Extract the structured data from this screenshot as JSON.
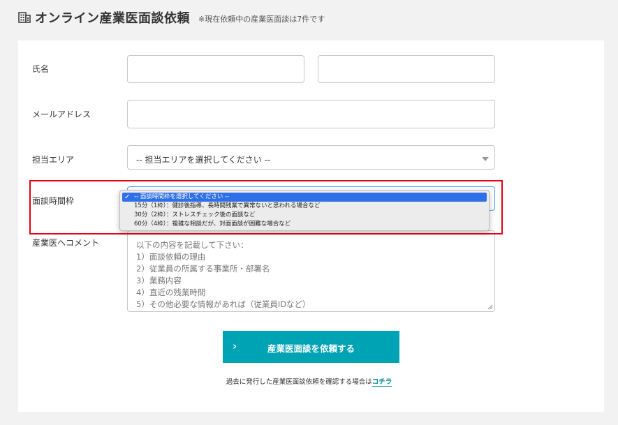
{
  "header": {
    "title": "オンライン産業医面談依頼",
    "subtitle": "※現在依頼中の産業医面談は7件です"
  },
  "form": {
    "name_label": "氏名",
    "email_label": "メールアドレス",
    "area_label": "担当エリア",
    "area_selected": "-- 担当エリアを選択してください --",
    "timeslot_label": "面談時間枠",
    "comment_label": "産業医へコメント",
    "comment_placeholder_lines": [
      "以下の内容を記載して下さい：",
      "1）面談依頼の理由",
      "2）従業員の所属する事業所・部署名",
      "3）業務内容",
      "4）直近の残業時間",
      "5）その他必要な情報があれば（従業員IDなど）"
    ]
  },
  "dropdown": {
    "options": [
      "-- 面談時間枠を選択してください --",
      "15分（1枠）：健診後指導、長時間残業で異常ないと思われる場合など",
      "30分（2枠）：ストレスチェック後の面談など",
      "60分（4枠）：複雑な相談だが、対面面談が困難な場合など"
    ],
    "selected_index": 0
  },
  "submit": {
    "chevron": "›",
    "label": "産業医面談を依頼する"
  },
  "footer": {
    "text": "過去に発行した産業医面談依頼を確認する場合は",
    "link": "コチラ"
  },
  "colors": {
    "accent": "#00a3b4",
    "highlight": "#e60012",
    "selected_option": "#2f6fe8"
  },
  "icons": {
    "header": "building-icon",
    "option_check": "checkmark-icon"
  }
}
